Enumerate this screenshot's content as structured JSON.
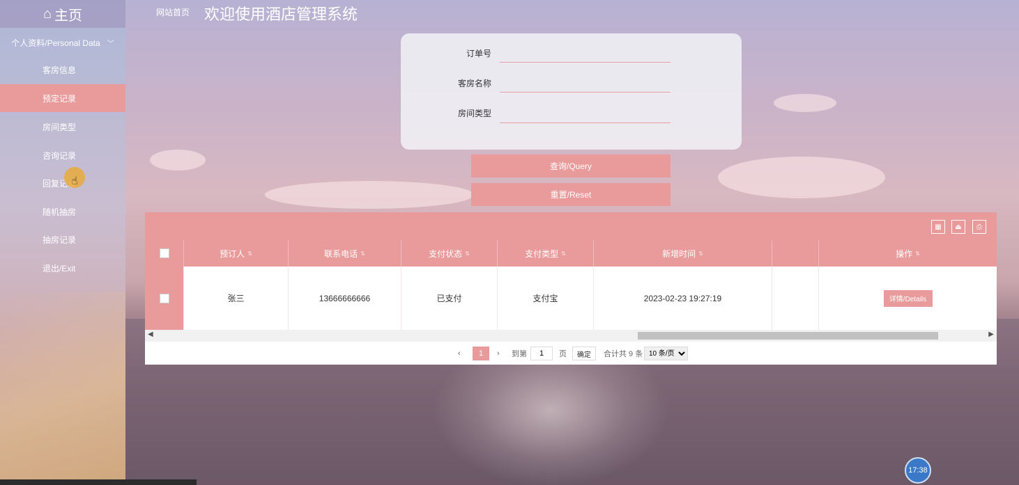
{
  "brand": {
    "icon": "home-icon",
    "title": "主页"
  },
  "header": {
    "breadcrumb": "网站首页",
    "title": "欢迎使用酒店管理系统"
  },
  "sidebar": {
    "section": "个人资料/Personal Data",
    "items": [
      {
        "label": "客房信息",
        "active": false
      },
      {
        "label": "预定记录",
        "active": true
      },
      {
        "label": "房间类型",
        "active": false
      },
      {
        "label": "咨询记录",
        "active": false
      },
      {
        "label": "回复记录",
        "active": false
      },
      {
        "label": "随机抽房",
        "active": false
      },
      {
        "label": "抽房记录",
        "active": false
      },
      {
        "label": "退出/Exit",
        "active": false
      }
    ]
  },
  "search": {
    "fields": [
      {
        "label": "订单号",
        "value": ""
      },
      {
        "label": "客房名称",
        "value": ""
      },
      {
        "label": "房间类型",
        "value": ""
      }
    ],
    "query_label": "查询/Query",
    "reset_label": "重置/Reset"
  },
  "table": {
    "toolbar_icons": [
      "columns-icon",
      "export-icon",
      "print-icon"
    ],
    "columns": [
      "预订人",
      "联系电话",
      "支付状态",
      "支付类型",
      "新增时间",
      "",
      "操作"
    ],
    "rows": [
      {
        "name": "张三",
        "phone": "13666666666",
        "pay_status": "已支付",
        "pay_type": "支付宝",
        "created": "2023-02-23 19:27:19",
        "blank": "",
        "action": "详情/Details"
      }
    ]
  },
  "pagination": {
    "prev": "‹",
    "current_page": "1",
    "next": "›",
    "goto_label": "到第",
    "goto_value": "1",
    "page_unit": "页",
    "confirm": "确定",
    "total": "合计共 9 条",
    "page_size": "10 条/页"
  },
  "clock": "17:38",
  "colors": {
    "accent": "#e99a9a",
    "panel": "#f0f0f5"
  }
}
